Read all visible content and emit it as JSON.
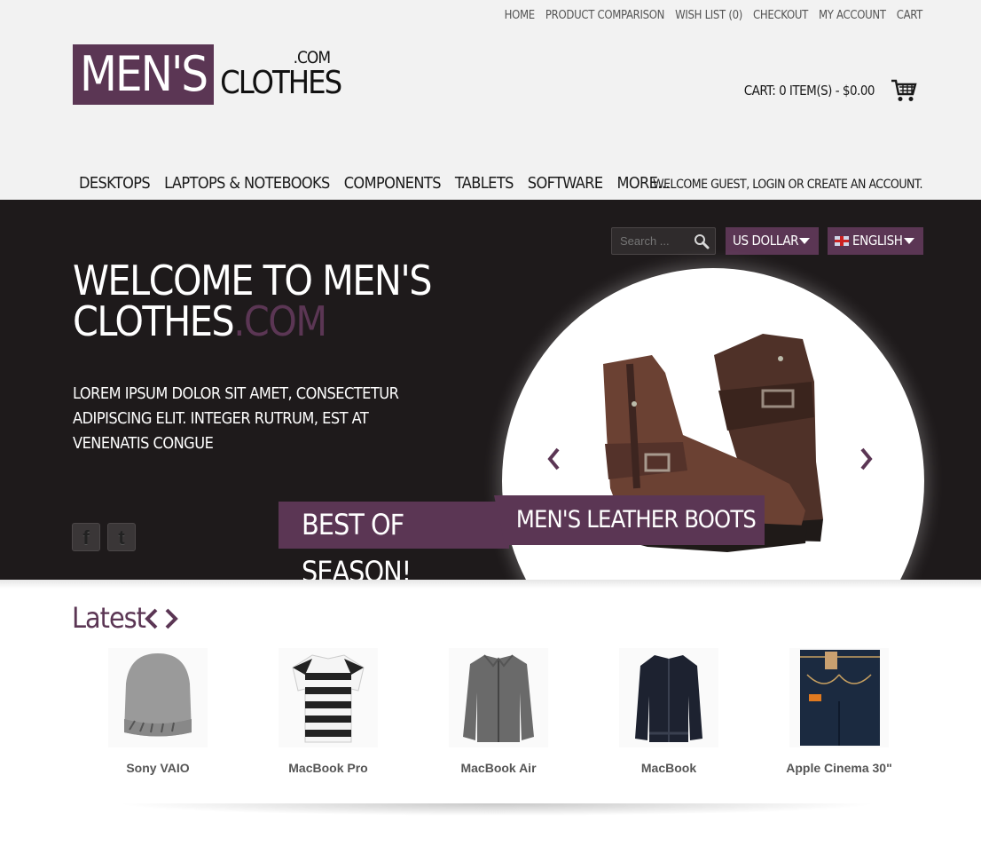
{
  "top_links": [
    "HOME",
    "PRODUCT COMPARISON",
    "WISH LIST (0)",
    "CHECKOUT",
    "MY ACCOUNT",
    "CART"
  ],
  "logo": {
    "box_text": "MEN'S",
    "com": ".COM",
    "clothes": "CLOTHES"
  },
  "cart_summary": "CART: 0 ITEM(S) - $0.00",
  "main_nav": [
    "DESKTOPS",
    "LAPTOPS & NOTEBOOKS",
    "COMPONENTS",
    "TABLETS",
    "SOFTWARE",
    "MORE..."
  ],
  "welcome": {
    "prefix": "WELCOME GUEST, ",
    "login": "LOGIN",
    "or": " OR ",
    "create": "CREATE AN ACCOUNT",
    "suffix": "."
  },
  "search": {
    "placeholder": "Search ..."
  },
  "currency": "US DOLLAR",
  "language": "ENGLISH",
  "hero": {
    "title_line1": "WELCOME TO MEN'S",
    "title_line2_main": "CLOTHES",
    "title_line2_accent": ".COM",
    "text": "LOREM IPSUM DOLOR SIT AMET, CONSECTETUR ADIPISCING ELIT. INTEGER RUTRUM, EST AT VENENATIS CONGUE",
    "banner_left": "BEST OF SEASON!",
    "banner_right": "MEN'S LEATHER BOOTS"
  },
  "latest": {
    "title": "Latest",
    "products": [
      {
        "name": "Sony VAIO"
      },
      {
        "name": "MacBook Pro"
      },
      {
        "name": "MacBook Air"
      },
      {
        "name": "MacBook"
      },
      {
        "name": "Apple Cinema 30\""
      }
    ]
  },
  "colors": {
    "accent": "#5b3654",
    "hero_bg": "#1e1a1b",
    "header_bg": "#f2f2f2"
  }
}
